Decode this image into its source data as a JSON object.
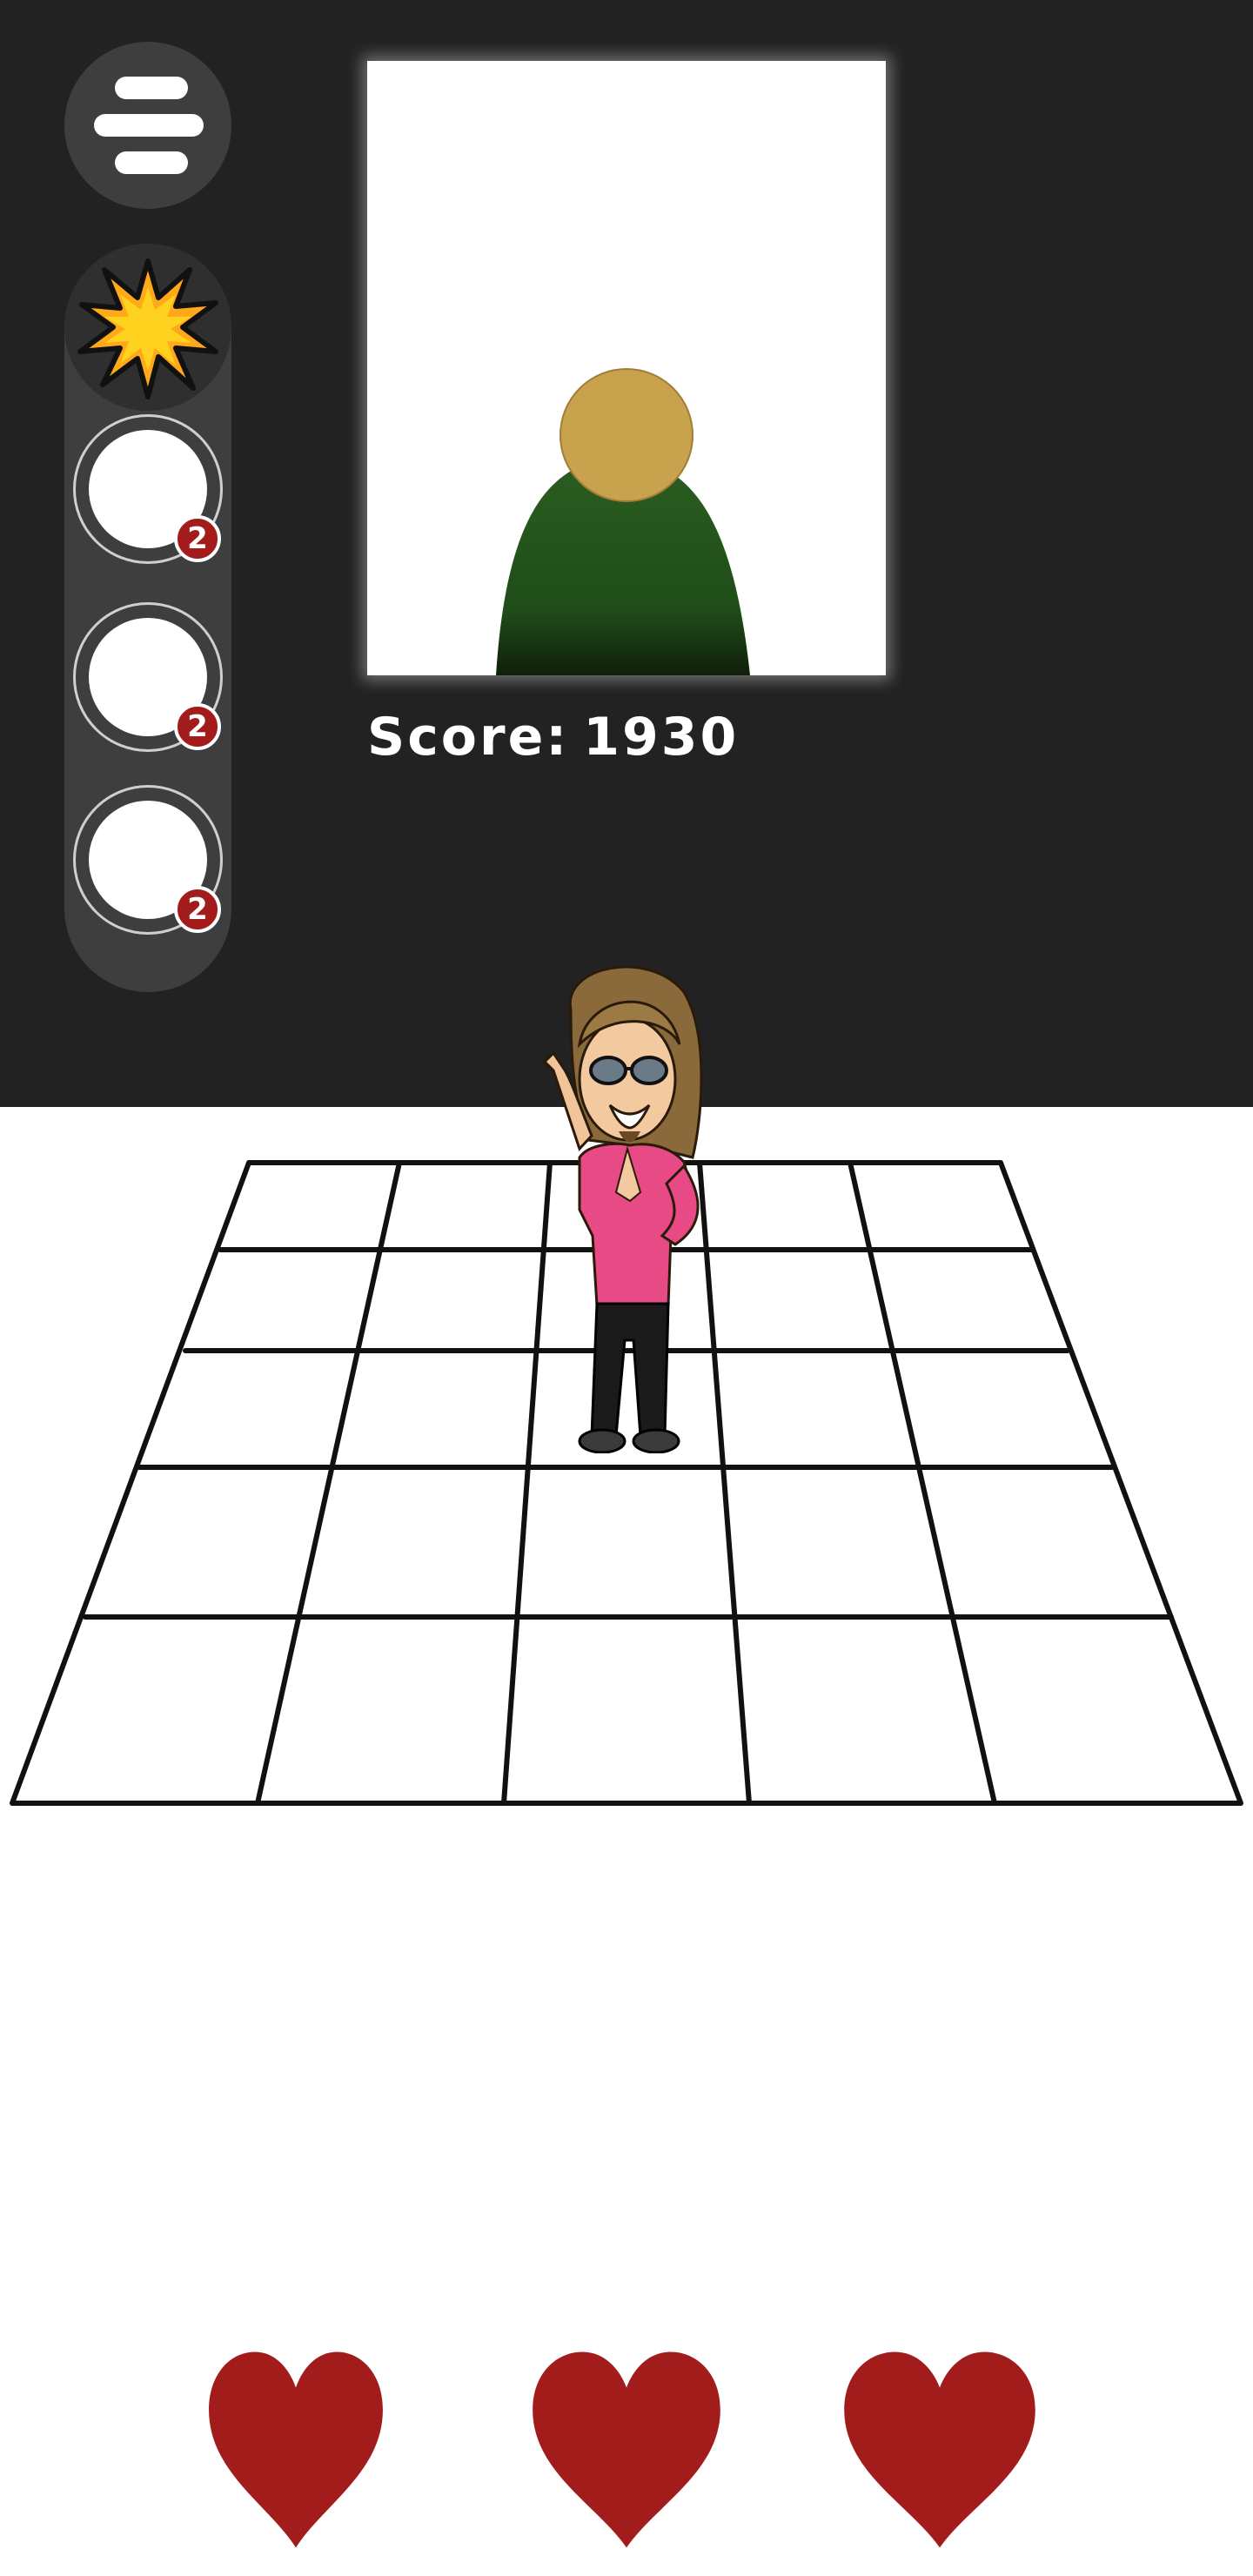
{
  "score": {
    "label": "Score:",
    "value": "1930"
  },
  "menu": {
    "icon": "hamburger-menu-icon"
  },
  "powerups": {
    "burst_icon": "starburst-icon",
    "slots": [
      {
        "count": "2"
      },
      {
        "count": "2"
      },
      {
        "count": "2"
      }
    ]
  },
  "board": {
    "rows": 5,
    "cols": 5
  },
  "lives": {
    "count": 3,
    "icon": "heart-icon"
  },
  "colors": {
    "background_top": "#222222",
    "panel": "#3e3e3e",
    "badge": "#a31c1c",
    "heart": "#a31c1c",
    "target_head": "#c9a24e",
    "target_body": "#1f4d18"
  }
}
